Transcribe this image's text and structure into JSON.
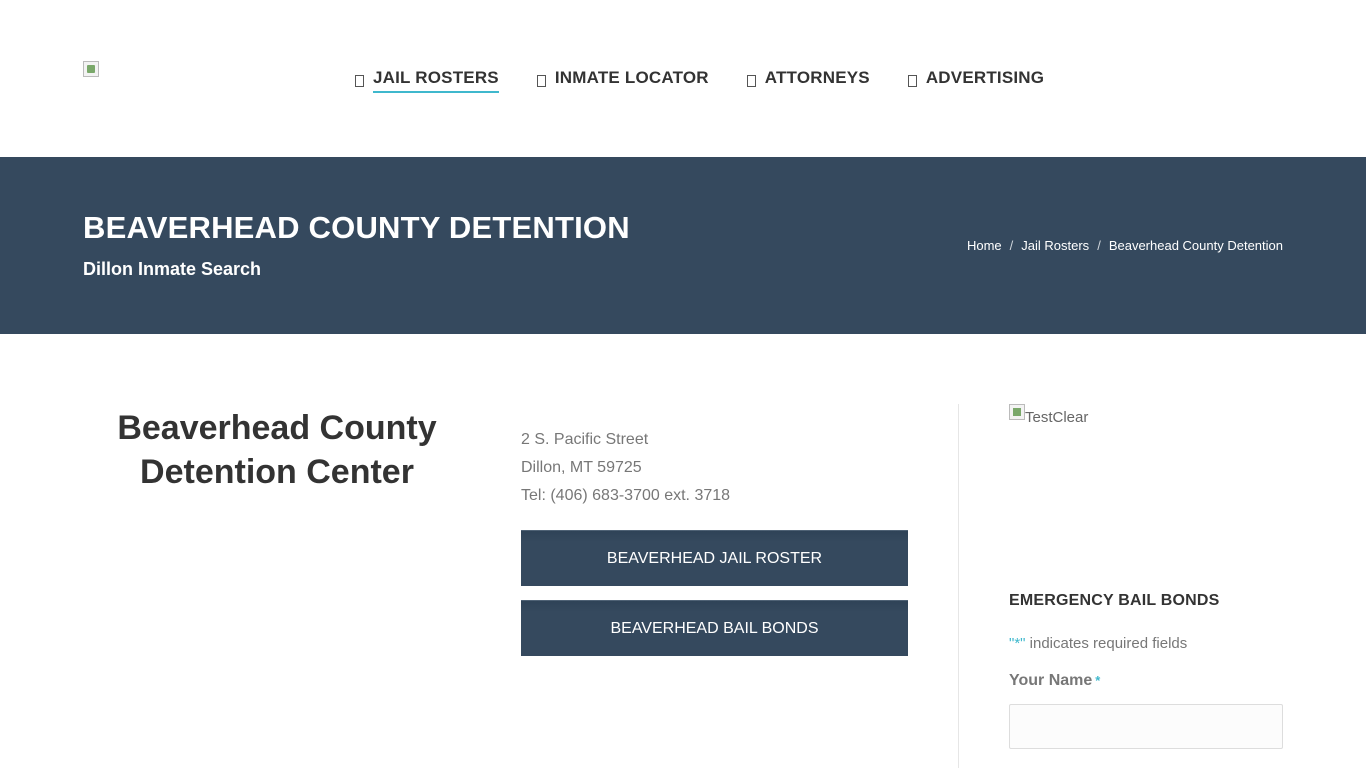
{
  "header": {
    "nav": [
      {
        "label": "JAIL ROSTERS",
        "active": true
      },
      {
        "label": "INMATE LOCATOR",
        "active": false
      },
      {
        "label": "ATTORNEYS",
        "active": false
      },
      {
        "label": "ADVERTISING",
        "active": false
      }
    ]
  },
  "banner": {
    "title": "BEAVERHEAD COUNTY DETENTION",
    "subtitle": "Dillon Inmate Search",
    "breadcrumbs": [
      "Home",
      "Jail Rosters",
      "Beaverhead County Detention"
    ],
    "separator": "/"
  },
  "main": {
    "facility_title": "Beaverhead County Detention Center",
    "address": {
      "street": "2 S. Pacific Street",
      "city": "Dillon, MT 59725",
      "phone": "Tel: (406) 683-3700 ext. 3718"
    },
    "buttons": {
      "roster": "BEAVERHEAD JAIL ROSTER",
      "bonds": "BEAVERHEAD BAIL BONDS"
    }
  },
  "sidebar": {
    "ad_alt": "TestClear",
    "form_title": "EMERGENCY BAIL BONDS",
    "required_star": "\"*\"",
    "required_text": " indicates required fields",
    "name_label": "Your Name",
    "name_required": "*",
    "name_value": ""
  },
  "colors": {
    "banner_bg": "#35495e",
    "accent": "#3fb8cd",
    "button_bg": "#35495e"
  }
}
